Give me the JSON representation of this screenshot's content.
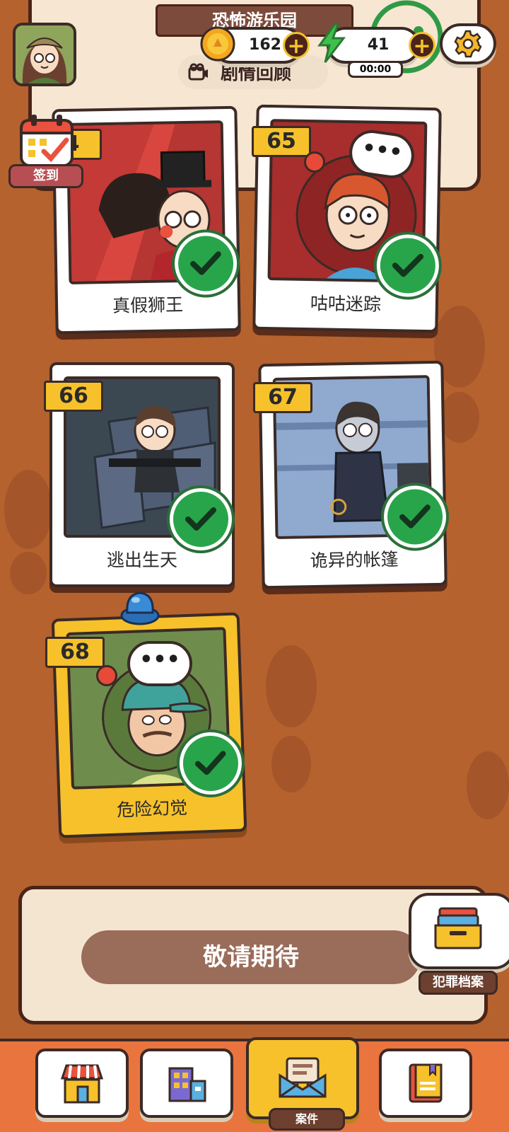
{
  "header": {
    "chapter_title": "恐怖游乐园",
    "review_label": "剧情回顾"
  },
  "currency": {
    "coins": "162",
    "energy": "41",
    "energy_timer": "00:00"
  },
  "checkin": {
    "label": "签到"
  },
  "cases": [
    {
      "number": "4",
      "title": "真假狮王",
      "completed": true,
      "bg": "#d9463f"
    },
    {
      "number": "65",
      "title": "咕咕迷踪",
      "completed": true,
      "bg": "#a82d2d"
    },
    {
      "number": "66",
      "title": "逃出生天",
      "completed": true,
      "bg": "#35414a"
    },
    {
      "number": "67",
      "title": "诡异的帐篷",
      "completed": true,
      "bg": "#7f9dc3"
    },
    {
      "number": "68",
      "title": "危险幻觉",
      "completed": true,
      "bg": "#6b8a48"
    }
  ],
  "speech_bubble_text": "•••",
  "coming_soon": "敬请期待",
  "archive": {
    "label": "犯罪档案"
  },
  "nav": {
    "active_label": "案件",
    "items": [
      "shop-icon",
      "city-icon",
      "case-mail-icon",
      "book-icon"
    ]
  },
  "colors": {
    "background": "#b5622e",
    "accent_yellow": "#f6c12a",
    "check_green": "#28a54a",
    "dark_outline": "#3b2a26"
  }
}
